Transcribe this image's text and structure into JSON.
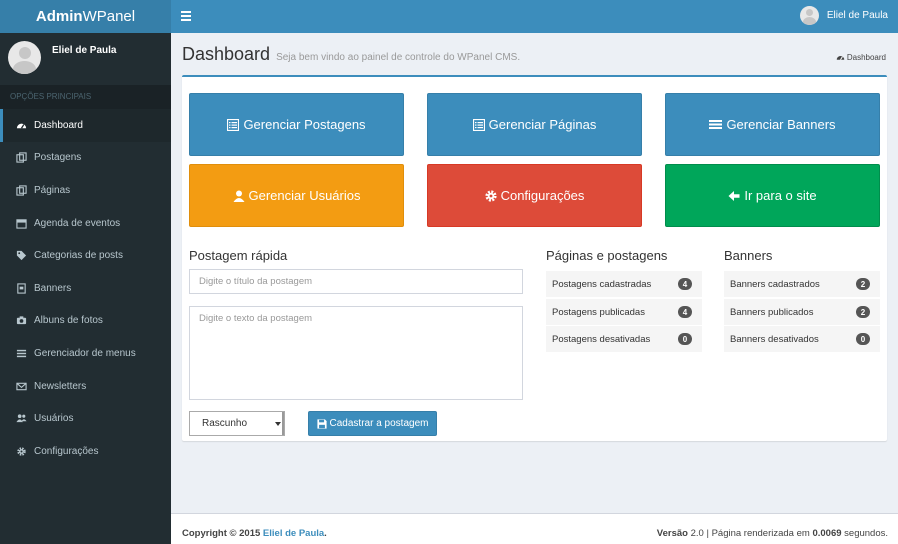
{
  "header": {
    "logo_bold": "Admin",
    "logo_rest": "WPanel",
    "user_name": "Eliel de Paula"
  },
  "sidebar": {
    "user_name": "Eliel de Paula",
    "section_header": "OPÇÕES PRINCIPAIS",
    "items": [
      {
        "label": "Dashboard",
        "icon": "dashboard-icon"
      },
      {
        "label": "Postagens",
        "icon": "copy-icon"
      },
      {
        "label": "Páginas",
        "icon": "copy-icon"
      },
      {
        "label": "Agenda de eventos",
        "icon": "calendar-icon"
      },
      {
        "label": "Categorias de posts",
        "icon": "tag-icon"
      },
      {
        "label": "Banners",
        "icon": "banner-icon"
      },
      {
        "label": "Albuns de fotos",
        "icon": "camera-icon"
      },
      {
        "label": "Gerenciador de menus",
        "icon": "list-icon"
      },
      {
        "label": "Newsletters",
        "icon": "envelope-icon"
      },
      {
        "label": "Usuários",
        "icon": "users-icon"
      },
      {
        "label": "Configurações",
        "icon": "gear-icon"
      }
    ]
  },
  "page": {
    "title": "Dashboard",
    "subtitle": "Seja bem vindo ao painel de controle do WPanel CMS.",
    "breadcrumb": "Dashboard"
  },
  "tiles": {
    "posts": "Gerenciar Postagens",
    "pages": "Gerenciar Páginas",
    "banners": "Gerenciar Banners",
    "users": "Gerenciar Usuários",
    "settings": "Configurações",
    "site": "Ir para o site"
  },
  "quick_post": {
    "title": "Postagem rápida",
    "title_placeholder": "Digite o título da postagem",
    "text_placeholder": "Digite o texto da postagem",
    "status_selected": "Rascunho",
    "submit_label": "Cadastrar a postagem"
  },
  "pages_posts": {
    "title": "Páginas e postagens",
    "rows": [
      {
        "label": "Postagens cadastradas",
        "count": "4"
      },
      {
        "label": "Postagens publicadas",
        "count": "4"
      },
      {
        "label": "Postagens desativadas",
        "count": "0"
      }
    ]
  },
  "banners": {
    "title": "Banners",
    "rows": [
      {
        "label": "Banners cadastrados",
        "count": "2"
      },
      {
        "label": "Banners publicados",
        "count": "2"
      },
      {
        "label": "Banners desativados",
        "count": "0"
      }
    ]
  },
  "footer": {
    "copyright": "Copyright © 2015",
    "author": "Eliel de Paula",
    "period": ".",
    "version_label": "Versão",
    "version": "2.0",
    "render_text": "| Página renderizada em",
    "render_time": "0.0069",
    "render_unit": "segundos."
  },
  "colors": {
    "primary": "#3c8dbc",
    "warning": "#f39c12",
    "danger": "#dd4b39",
    "success": "#00a65a",
    "sidebar": "#222d32"
  }
}
